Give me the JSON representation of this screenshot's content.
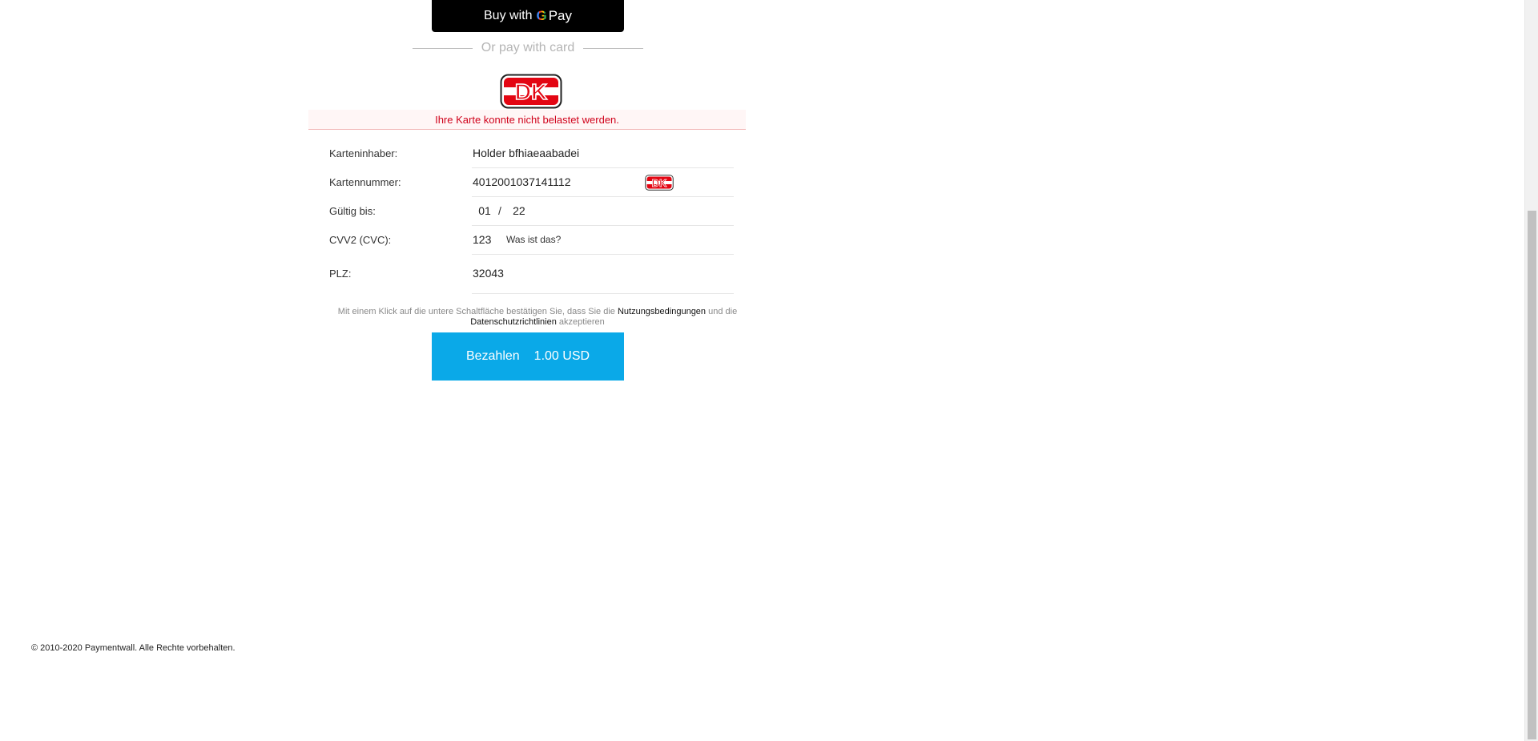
{
  "gpay": {
    "buy_with": "Buy with",
    "g_letter": "G",
    "pay": "Pay"
  },
  "divider": {
    "text": "Or pay with card"
  },
  "logo": {
    "text": "DK",
    "color": "#e30613"
  },
  "error": {
    "message": "Ihre Karte konnte nicht belastet werden."
  },
  "form": {
    "holder_label": "Karteninhaber:",
    "holder_value": "Holder bfhiaeaabadei",
    "number_label": "Kartennummer:",
    "number_value": "4012001037141112",
    "expiry_label": "Gültig bis:",
    "expiry_month": "01",
    "expiry_sep": "/",
    "expiry_year": "22",
    "cvv_label": "CVV2 (CVC):",
    "cvv_value": "123",
    "cvv_help": "Was ist das?",
    "zip_label": "PLZ:",
    "zip_value": "32043"
  },
  "terms": {
    "prefix": "Mit einem Klick auf die untere Schaltfläche bestätigen Sie, dass Sie die",
    "terms_link": "Nutzungsbedingungen",
    "middle": "und die",
    "privacy_link": "Datenschutzrichtlinien",
    "suffix": "akzeptieren"
  },
  "pay_button": {
    "label": "Bezahlen",
    "amount": "1.00 USD",
    "color": "#0aa9e8"
  },
  "footer": {
    "copyright": "© 2010-2020 Paymentwall. Alle Rechte vorbehalten."
  }
}
